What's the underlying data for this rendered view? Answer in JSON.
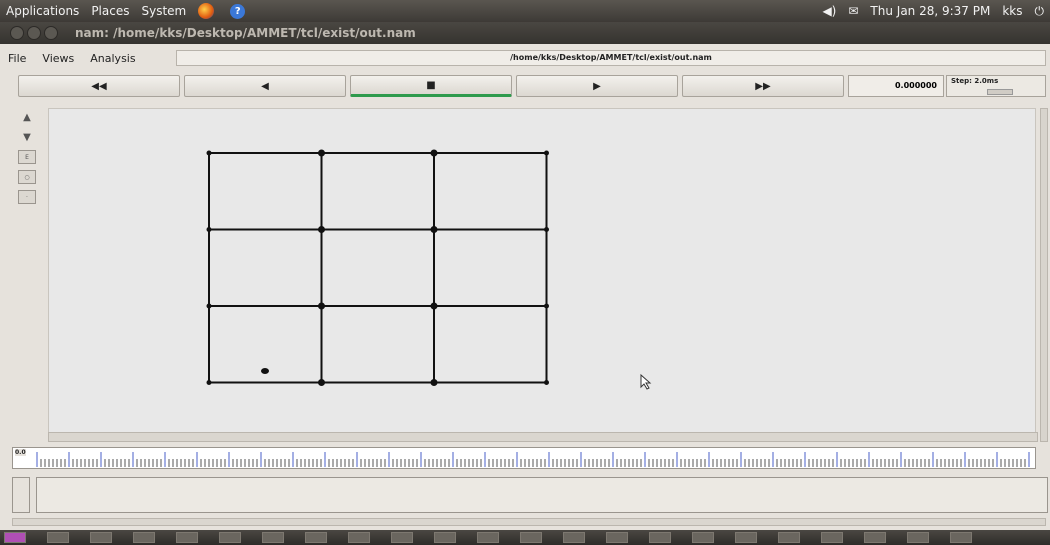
{
  "top_panel": {
    "menus": [
      "Applications",
      "Places",
      "System"
    ],
    "datetime": "Thu Jan 28, 9:37 PM",
    "user": "kks"
  },
  "window": {
    "title": "nam: /home/kks/Desktop/AMMET/tcl/exist/out.nam"
  },
  "menubar": {
    "items": [
      "File",
      "Views",
      "Analysis"
    ],
    "filepath": "/home/kks/Desktop/AMMET/tcl/exist/out.nam"
  },
  "controls": {
    "rewind": "◀◀",
    "back": "◀",
    "stop": "■",
    "play": "▶",
    "fast_forward": "▶▶",
    "time": "0.000000",
    "step": "Step: 2.0ms"
  },
  "timeline": {
    "label": "0.0"
  },
  "network": {
    "cols": 4,
    "rows": 4,
    "extra_node": "mobile-node"
  },
  "colors": {
    "panel": "#3d3a36",
    "active_indicator": "#2e9a4c",
    "canvas": "#e8e8e8",
    "link": "#111111"
  }
}
